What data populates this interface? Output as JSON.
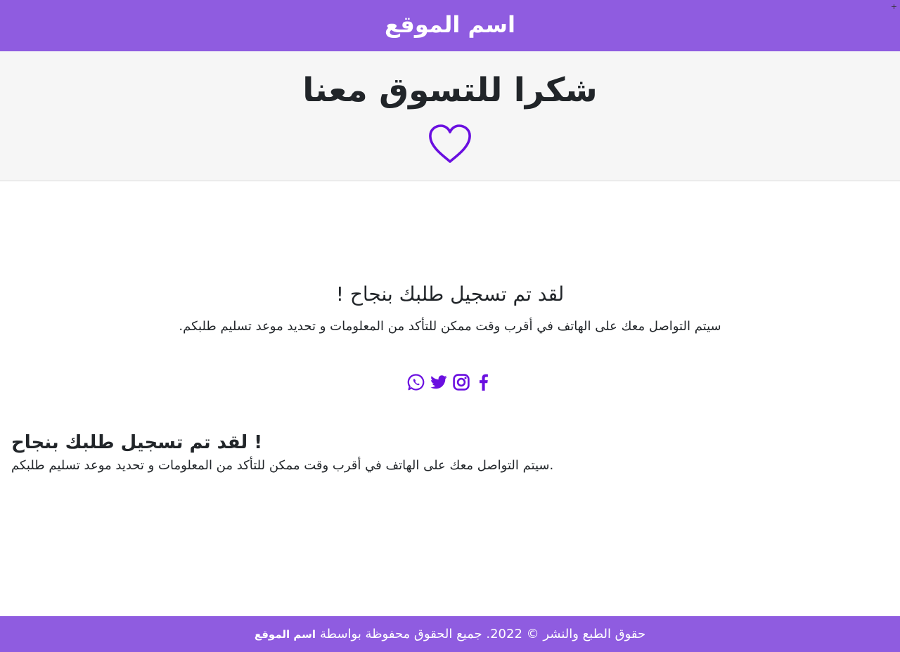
{
  "header": {
    "site_name": "اسم الموقع",
    "corner_mark": "+"
  },
  "hero": {
    "title": "شكرا للتسوق معنا",
    "icon": "heart-icon",
    "accent": "#6a0fe0"
  },
  "confirmation": {
    "title": "لقد تم تسجيل طلبك بنجاح !",
    "text": "سيتم التواصل معك على الهاتف في أقرب وقت ممكن للتأكد من المعلومات و تحديد موعد تسليم طلبكم."
  },
  "social": [
    {
      "name": "whatsapp-icon"
    },
    {
      "name": "twitter-icon"
    },
    {
      "name": "instagram-icon"
    },
    {
      "name": "facebook-icon"
    }
  ],
  "confirmation_secondary": {
    "title": "لقد تم تسجيل طلبك بنجاح !",
    "text": "سيتم التواصل معك على الهاتف في أقرب وقت ممكن للتأكد من المعلومات و تحديد موعد تسليم طلبكم."
  },
  "footer": {
    "copyright": "حقوق الطبع والنشر © 2022. جميع الحقوق محفوظة بواسطة",
    "site_name": "اسم الموقع"
  },
  "colors": {
    "brand": "#8f5ce0",
    "accent": "#6a0fe0",
    "hero_bg": "#f6f6f6",
    "text": "#212529"
  }
}
